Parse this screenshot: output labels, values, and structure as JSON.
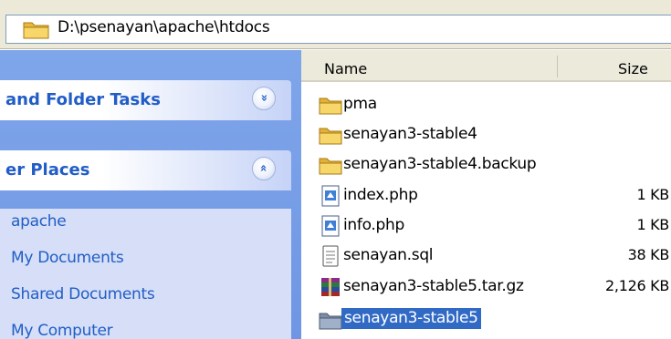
{
  "address_bar": {
    "path": "D:\\psenayan\\apache\\htdocs",
    "icon": "folder-icon"
  },
  "task_pane": {
    "sections": [
      {
        "title": "and Folder Tasks",
        "toggle_icon": "chevron-double-down-icon",
        "toggle_glyph": "»"
      },
      {
        "title": "er Places",
        "toggle_icon": "chevron-double-up-icon",
        "toggle_glyph": "»"
      }
    ],
    "other_places": [
      "apache",
      "My Documents",
      "Shared Documents",
      "My Computer"
    ]
  },
  "file_list": {
    "columns": {
      "name": "Name",
      "size": "Size"
    },
    "rows": [
      {
        "name": "pma",
        "size": "",
        "icon": "folder-icon",
        "selected": false
      },
      {
        "name": "senayan3-stable4",
        "size": "",
        "icon": "folder-icon",
        "selected": false
      },
      {
        "name": "senayan3-stable4.backup",
        "size": "",
        "icon": "folder-icon",
        "selected": false
      },
      {
        "name": "index.php",
        "size": "1 KB",
        "icon": "php-file-icon",
        "selected": false
      },
      {
        "name": "info.php",
        "size": "1 KB",
        "icon": "php-file-icon",
        "selected": false
      },
      {
        "name": "senayan.sql",
        "size": "38 KB",
        "icon": "text-file-icon",
        "selected": false
      },
      {
        "name": "senayan3-stable5.tar.gz",
        "size": "2,126 KB",
        "icon": "archive-icon",
        "selected": false
      },
      {
        "name": "senayan3-stable5",
        "size": "",
        "icon": "folder-icon",
        "selected": true
      }
    ]
  },
  "colors": {
    "pane_background": "#7fa6ea",
    "pane_link": "#215dc6",
    "selection": "#316ac5",
    "folder": "#f2cd5b"
  }
}
